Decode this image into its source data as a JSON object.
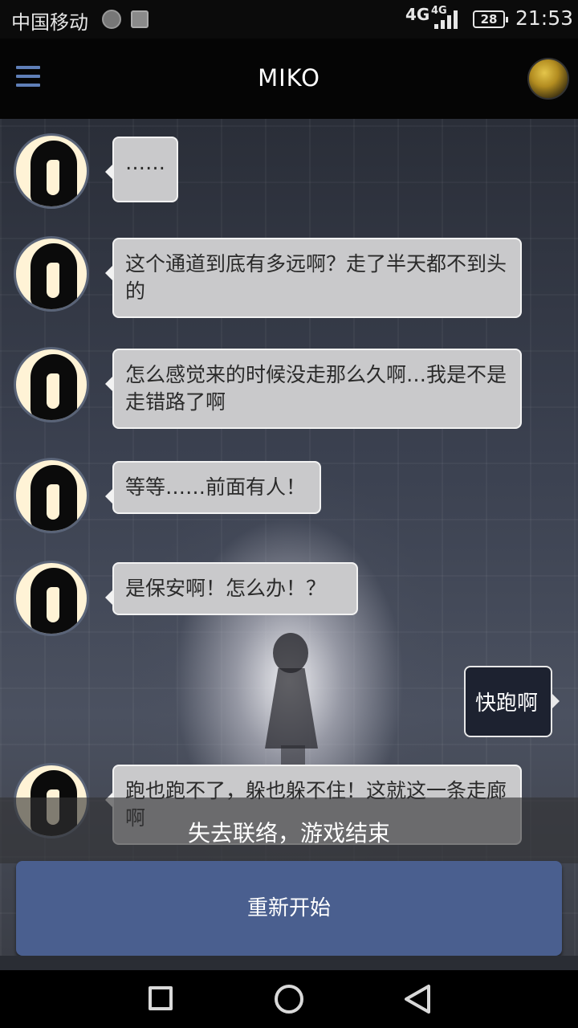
{
  "status_bar": {
    "carrier": "中国移动",
    "network_main": "4G",
    "network_small": "4G",
    "battery": "28",
    "time": "21:53"
  },
  "app_bar": {
    "title": "MIKO"
  },
  "messages": [
    {
      "from": "npc",
      "text": "……"
    },
    {
      "from": "npc",
      "text": "这个通道到底有多远啊？走了半天都不到头的"
    },
    {
      "from": "npc",
      "text": "怎么感觉来的时候没走那么久啊…我是不是走错路了啊"
    },
    {
      "from": "npc",
      "text": "等等……前面有人！"
    },
    {
      "from": "npc",
      "text": "是保安啊！怎么办！？"
    },
    {
      "from": "user",
      "text": "快跑啊"
    },
    {
      "from": "npc",
      "text": "跑也跑不了，躲也躲不住！这就这一条走廊啊"
    }
  ],
  "game_over": {
    "message": "失去联络，游戏结束",
    "restart_label": "重新开始"
  },
  "colors": {
    "accent": "#4a5f8f",
    "menu_icon": "#5f7fb8",
    "npc_bubble": "#c9c9cb",
    "user_bubble": "#1d2230"
  },
  "icons": {
    "menu": "hamburger-menu-icon",
    "nav_recent": "square-icon",
    "nav_home": "circle-icon",
    "nav_back": "triangle-back-icon"
  }
}
